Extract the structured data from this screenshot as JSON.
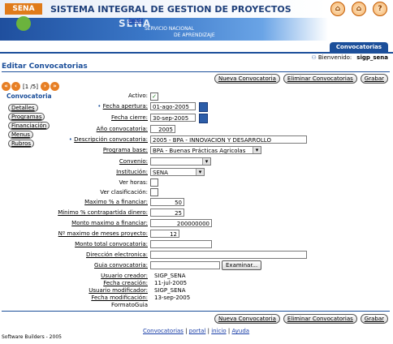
{
  "header": {
    "app_title": "SISTEMA INTEGRAL DE GESTION DE PROYECTOS",
    "logo_text": "SENA",
    "brand_big": "SENA",
    "brand_sub1": "SERVICIO NACIONAL",
    "brand_sub2": "DE APRENDIZAJE",
    "icons": [
      {
        "icon": "portal-icon",
        "label": "portal"
      },
      {
        "icon": "home-icon",
        "label": "inicio"
      },
      {
        "icon": "help-icon",
        "label": "Ayuda"
      }
    ]
  },
  "tabs": {
    "active": "Convocatorias"
  },
  "welcome": {
    "label": "Bienvenido:",
    "user": "sigp_sena"
  },
  "page": {
    "title": "Editar Convocatorias"
  },
  "actions": {
    "new": "Nueva Convocatoria",
    "delete": "Eliminar Convocatorias",
    "save": "Grabar"
  },
  "pager": {
    "text": "[1 /5]"
  },
  "sidebar": {
    "title": "Convocatoria",
    "items": [
      "Detalles",
      "Programas",
      "Financiación",
      "Menus",
      "Rubros"
    ]
  },
  "form": {
    "activo": {
      "label": "Activo:",
      "checked": true
    },
    "fecha_apertura": {
      "label": "Fecha apertura:",
      "value": "01-ago-2005"
    },
    "fecha_cierre": {
      "label": "Fecha cierre:",
      "value": "30-sep-2005"
    },
    "anio": {
      "label": "Año convocatoria:",
      "value": "2005"
    },
    "descripcion": {
      "label": "Descripción convocatoria:",
      "value": "2005 - BPA - INNOVACION Y DESARROLLO"
    },
    "programa": {
      "label": "Programa base:",
      "value": "BPA - Buenas Prácticas Agricolas"
    },
    "convenio": {
      "label": "Convenio:",
      "value": ""
    },
    "institucion": {
      "label": "Institución:",
      "value": "SENA"
    },
    "ver_horas": {
      "label": "Ver horas:"
    },
    "ver_clasificacion": {
      "label": "Ver clasificación:"
    },
    "max_pct": {
      "label": "Maximo % a financiar:",
      "value": "50"
    },
    "min_pct": {
      "label": "Minimo % contrapartida dinero:",
      "value": "25"
    },
    "monto_max": {
      "label": "Monto maximo a financiar:",
      "value": "200000000"
    },
    "meses": {
      "label": "Nº maximo de meses proyecto:",
      "value": "12"
    },
    "monto_total": {
      "label": "Monto total convocatoria:",
      "value": ""
    },
    "direccion": {
      "label": "Dirección electronica:",
      "value": ""
    },
    "guia": {
      "label": "Guia convocatoria:",
      "value": "",
      "button": "Examinar..."
    },
    "usuario_creador": {
      "label": "Usuario creador:",
      "value": "SIGP_SENA"
    },
    "fecha_creacion": {
      "label": "Fecha creación:",
      "value": "11-jul-2005"
    },
    "usuario_modificador": {
      "label": "Usuario modificador:",
      "value": "SIGP_SENA"
    },
    "fecha_modificacion": {
      "label": "Fecha modificación:",
      "value": "13-sep-2005"
    },
    "formato_guia": {
      "label": "FormatoGuia"
    }
  },
  "footer": {
    "links": [
      "Convocatorias",
      "portal",
      "inicio",
      "Ayuda"
    ],
    "separator": "|",
    "copyright": "Software Builders - 2005"
  },
  "colors": {
    "accent": "#1c4f9a",
    "orange": "#e77f24"
  }
}
